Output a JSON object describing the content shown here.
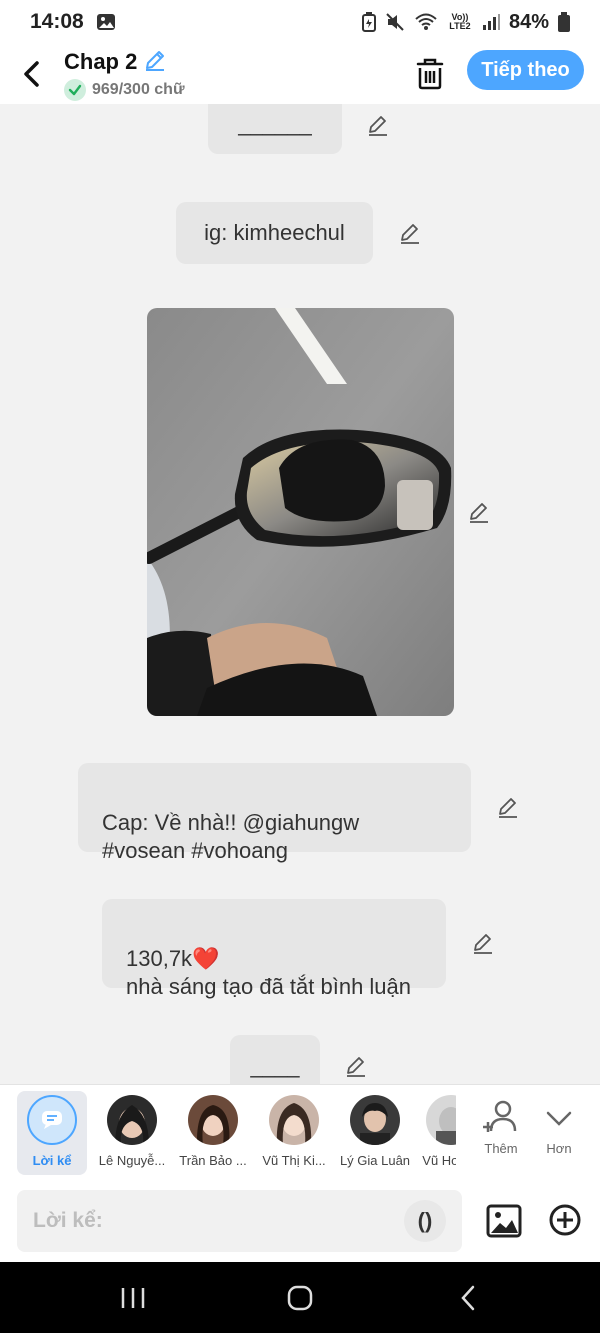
{
  "status": {
    "time": "14:08",
    "network": "Vo)) LTE2",
    "battery": "84%"
  },
  "header": {
    "title": "Chap 2",
    "word_count": "969/300 chữ",
    "next_label": "Tiếp theo"
  },
  "messages": [
    {
      "text": "______"
    },
    {
      "text": "ig: kimheechul"
    },
    {
      "type": "image"
    },
    {
      "text": "Cap: Về nhà!! @giahungw\n#vosean #vohoang"
    },
    {
      "text": "130,7k❤️\nnhà sáng tạo đã tắt bình luận"
    },
    {
      "text": "____"
    }
  ],
  "suggestions": {
    "active": "Lời kể",
    "characters": [
      "Lê Nguyễ...",
      "Trần Bảo ...",
      "Vũ Thị Ki...",
      "Lý Gia Luân",
      "Vũ Hơ"
    ],
    "add_label": "Thêm",
    "more_label": "Hơn"
  },
  "composer": {
    "placeholder": "Lời kể:",
    "paren_label": "()"
  },
  "icons": {
    "accent": "#4da6ff",
    "heart": "#e01b24"
  }
}
